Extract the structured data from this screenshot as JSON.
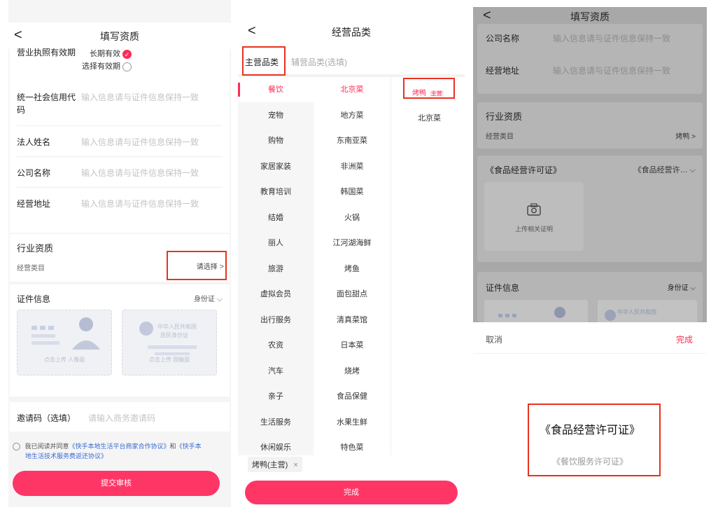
{
  "p1": {
    "nav_back": "<",
    "title": "填写资质",
    "license_label_partial": "营业执照有效期",
    "license_option_long": "长期有效",
    "license_option_range": "选择有效期",
    "form_rows": [
      {
        "label": "统一社会信用代",
        "label2": "码",
        "placeholder": "输入信息请与证件信息保持一致"
      },
      {
        "label": "法人姓名",
        "label2": "",
        "placeholder": "输入信息请与证件信息保持一致"
      },
      {
        "label": "公司名称",
        "label2": "",
        "placeholder": "输入信息请与证件信息保持一致"
      },
      {
        "label": "经营地址",
        "label2": "",
        "placeholder": "输入信息请与证件信息保持一致"
      }
    ],
    "industry_title": "行业资质",
    "category_label": "经营类目",
    "category_select": "请选择",
    "cert_title": "证件信息",
    "cert_type": "身份证",
    "id_front_text": "点击上传 人像面",
    "id_back_text": "点击上传 国徽面",
    "id_back_stamp": "中华人民共和国",
    "id_back_stamp2": "居民身份证",
    "invite_label": "邀请码（选填）",
    "invite_placeholder": "请输入商务邀请码",
    "agree_prefix": "我已阅读并同意",
    "agree_link1": "《快手本地生活平台商家合作协议》",
    "agree_and": "和",
    "agree_link2a": "《快手本",
    "agree_link2b": "地生活技术服务费返还协议》",
    "submit": "提交审核"
  },
  "p2": {
    "nav_back": "<",
    "title": "经营品类",
    "tab_main": "主营品类",
    "tab_aux": "辅营品类(选填)",
    "left_items": [
      "餐饮",
      "宠物",
      "购物",
      "家居家装",
      "教育培训",
      "结婚",
      "丽人",
      "旅游",
      "虚拟会员",
      "出行服务",
      "农资",
      "汽车",
      "亲子",
      "生活服务",
      "休闲娱乐"
    ],
    "mid_items": [
      "北京菜",
      "地方菜",
      "东南亚菜",
      "非洲菜",
      "韩国菜",
      "火锅",
      "江河湖海鲜",
      "烤鱼",
      "面包甜点",
      "清真菜馆",
      "日本菜",
      "烧烤",
      "食品保健",
      "水果生鲜",
      "特色菜"
    ],
    "right_selected": "烤鸭",
    "right_badge": "主营",
    "right_other": "北京菜",
    "tag_text": "烤鸭(主营)",
    "tag_close": "×",
    "done": "完成"
  },
  "p3": {
    "nav_back": "<",
    "title": "填写资质",
    "company_label": "公司名称",
    "company_placeholder": "输入信息请与证件信息保持一致",
    "address_label": "经营地址",
    "address_placeholder": "输入信息请与证件信息保持一致",
    "industry_title": "行业资质",
    "category_label": "经营类目",
    "category_value": "烤鸭",
    "license_label": "《食品经营许可证》",
    "license_value": "《食品经营许…",
    "upload_label": "上传相关证明",
    "cert_title": "证件信息",
    "cert_type": "身份证",
    "id_back_stamp": "中华人民共和国",
    "cancel": "取消",
    "confirm": "完成",
    "picker_selected": "《食品经营许可证》",
    "picker_other": "《餐饮服务许可证》"
  },
  "colors": {
    "accent": "#fe2c55",
    "highlight_box": "#e8321f"
  }
}
